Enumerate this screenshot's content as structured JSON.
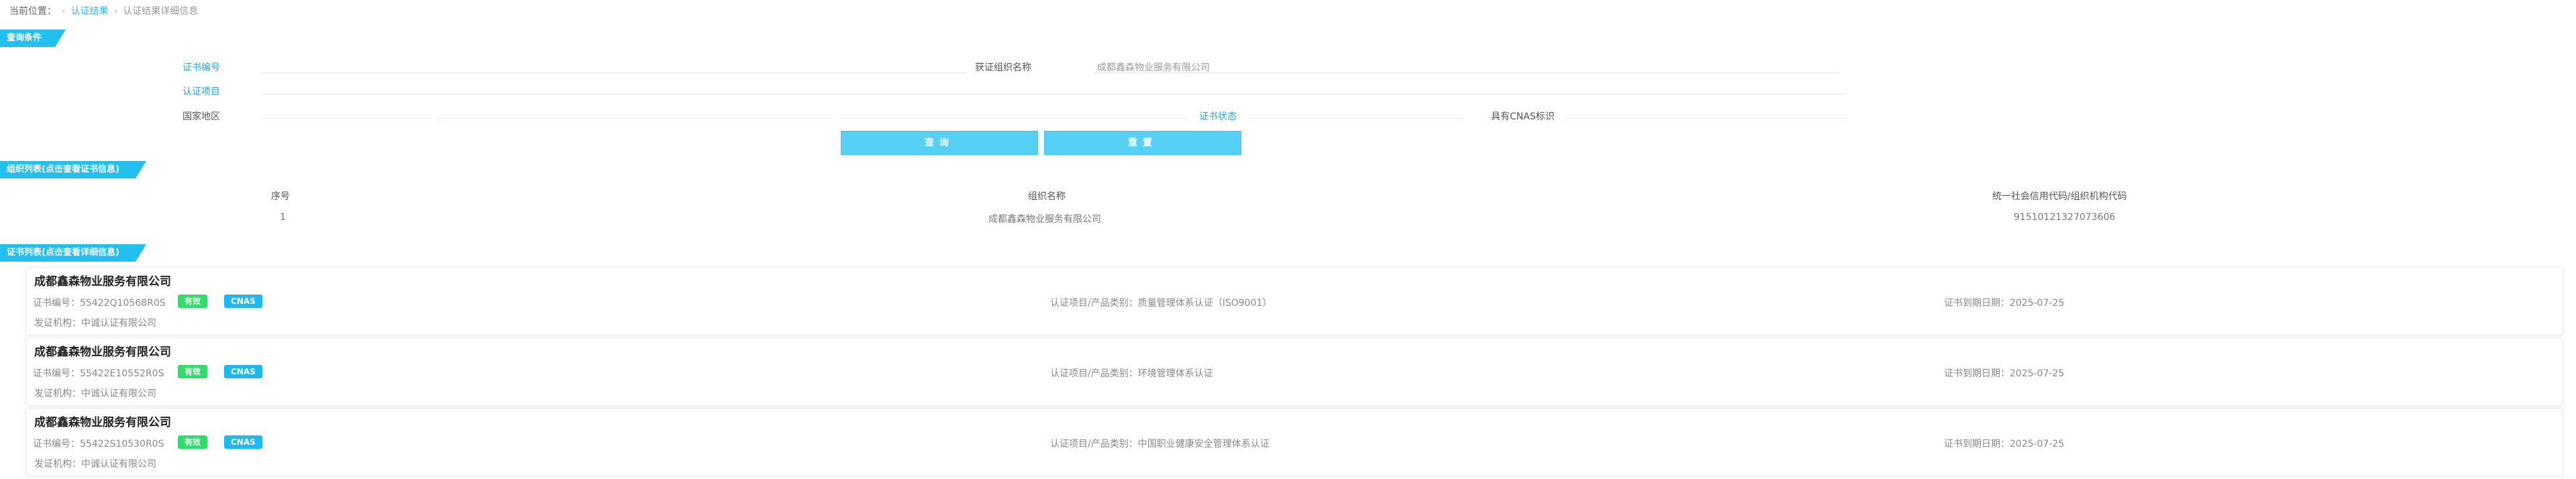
{
  "breadcrumb": {
    "current_label": "当前位置：",
    "level1": "认证结果",
    "level2": "认证结果详细信息"
  },
  "query": {
    "section_title": "查询条件",
    "cert_no_label": "证书编号",
    "org_name_label": "获证组织名称",
    "org_name_value": "成都鑫森物业服务有限公司",
    "project_label": "认证项目",
    "region_label": "国家地区",
    "status_label": "证书状态",
    "cnas_label": "具有CNAS标识",
    "search_button": "查询",
    "reset_button": "重置"
  },
  "org_list": {
    "section_title": "组织列表(点击查看证书信息)",
    "headers": [
      "序号",
      "组织名称",
      "统一社会信用代码/组织机构代码"
    ],
    "rows": [
      {
        "index": "1",
        "name": "成都鑫森物业服务有限公司",
        "code": "91510121327073606"
      }
    ]
  },
  "cert_list": {
    "section_title": "证书列表(点击查看详细信息)",
    "cert_no_label": "证书编号：",
    "project_label": "认证项目/产品类别：",
    "expiry_label": "证书到期日期：",
    "issuer_label": "发证机构：",
    "items": [
      {
        "company": "成都鑫森物业服务有限公司",
        "cert_no": "55422Q10568R0S",
        "status_badge": "有效",
        "cnas_badge": "CNAS",
        "project": "质量管理体系认证（ISO9001）",
        "expiry": "2025-07-25",
        "issuer": "中诚认证有限公司"
      },
      {
        "company": "成都鑫森物业服务有限公司",
        "cert_no": "55422E10552R0S",
        "status_badge": "有效",
        "cnas_badge": "CNAS",
        "project": "环境管理体系认证",
        "expiry": "2025-07-25",
        "issuer": "中诚认证有限公司"
      },
      {
        "company": "成都鑫森物业服务有限公司",
        "cert_no": "55422S10530R0S",
        "status_badge": "有效",
        "cnas_badge": "CNAS",
        "project": "中国职业健康安全管理体系认证",
        "expiry": "2025-07-25",
        "issuer": "中诚认证有限公司"
      }
    ]
  }
}
